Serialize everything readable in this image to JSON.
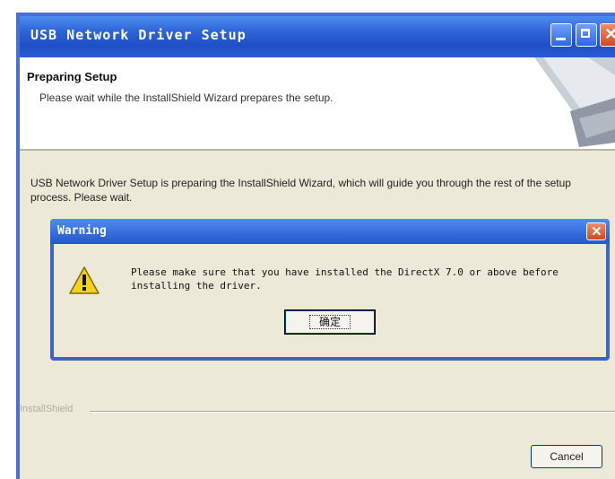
{
  "window": {
    "title": "USB Network Driver Setup"
  },
  "header": {
    "title": "Preparing Setup",
    "subtitle": "Please wait while the InstallShield Wizard prepares the setup."
  },
  "body": {
    "message": "USB Network Driver Setup is preparing the InstallShield Wizard, which will guide you through the rest of the setup process. Please wait."
  },
  "warning_dialog": {
    "title": "Warning",
    "message": "Please make sure that you have installed the DirectX 7.0 or above before installing the driver.",
    "ok_label": "确定",
    "icon": "warning-icon"
  },
  "footer": {
    "brand": "InstallShield",
    "cancel_label": "Cancel"
  },
  "colors": {
    "titlebar": "#2f66d9",
    "window_bg": "#ece9d8",
    "close_button": "#d24a1e"
  }
}
